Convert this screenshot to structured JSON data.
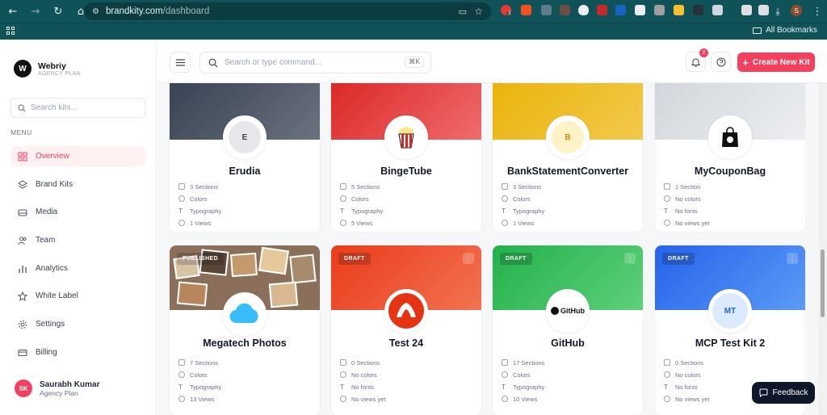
{
  "browser": {
    "url_domain": "brandkity.com",
    "url_path": "/dashboard",
    "bookmarks_label": "All Bookmarks",
    "profile_initial": "S",
    "ext_badge": "3"
  },
  "app": {
    "brand_name": "Webriy",
    "brand_plan": "AGENCY PLAN",
    "brand_initial": "W",
    "search_placeholder": "Search kits...",
    "menu_label": "MENU",
    "nav": [
      {
        "label": "Overview",
        "icon": "grid-icon"
      },
      {
        "label": "Brand Kits",
        "icon": "layers-icon"
      },
      {
        "label": "Media",
        "icon": "drive-icon"
      },
      {
        "label": "Team",
        "icon": "users-icon"
      },
      {
        "label": "Analytics",
        "icon": "bar-chart-icon"
      },
      {
        "label": "White Label",
        "icon": "star-icon"
      },
      {
        "label": "Settings",
        "icon": "gear-icon"
      },
      {
        "label": "Billing",
        "icon": "credit-card-icon"
      }
    ],
    "user": {
      "initials": "SK",
      "name": "Saurabh Kumar",
      "plan": "Agency Plan"
    }
  },
  "topbar": {
    "command_placeholder": "Search or type command...",
    "command_shortcut": "⌘K",
    "notification_count": "2",
    "create_label": "Create New Kit"
  },
  "kits": [
    {
      "title": "Erudia",
      "logo_text": "E",
      "sections": "3 Sections",
      "colors": "Colors",
      "typography": "Typography",
      "views": "1 Views"
    },
    {
      "title": "BingeTube",
      "logo_text": "",
      "sections": "5 Sections",
      "colors": "Colors",
      "typography": "Typography",
      "views": "5 Views"
    },
    {
      "title": "BankStatementConverter",
      "logo_text": "B",
      "sections": "3 Sections",
      "colors": "Colors",
      "typography": "Typography",
      "views": "1 Views"
    },
    {
      "title": "MyCouponBag",
      "logo_text": "",
      "sections": "1 Section",
      "colors": "No colors",
      "typography": "No fonts",
      "views": "No views yet"
    },
    {
      "title": "Megatech Photos",
      "badge": "PUBLISHED",
      "logo_text": "",
      "sections": "7 Sections",
      "colors": "Colors",
      "typography": "Typography",
      "views": "13 Views"
    },
    {
      "title": "Test 24",
      "badge": "DRAFT",
      "logo_text": "",
      "sections": "0 Sections",
      "colors": "No colors",
      "typography": "No fonts",
      "views": "No views yet"
    },
    {
      "title": "GitHub",
      "badge": "DRAFT",
      "logo_text": "GitHub",
      "sections": "17 Sections",
      "colors": "Colors",
      "typography": "Typography",
      "views": "10 Views"
    },
    {
      "title": "MCP Test Kit 2",
      "badge": "DRAFT",
      "logo_text": "MT",
      "sections": "0 Sections",
      "colors": "No colors",
      "typography": "No fonts",
      "views": "No views yet"
    }
  ],
  "feedback_label": "Feedback",
  "colors": {
    "accent": "#f43f5e",
    "chrome": "#0f5257"
  }
}
